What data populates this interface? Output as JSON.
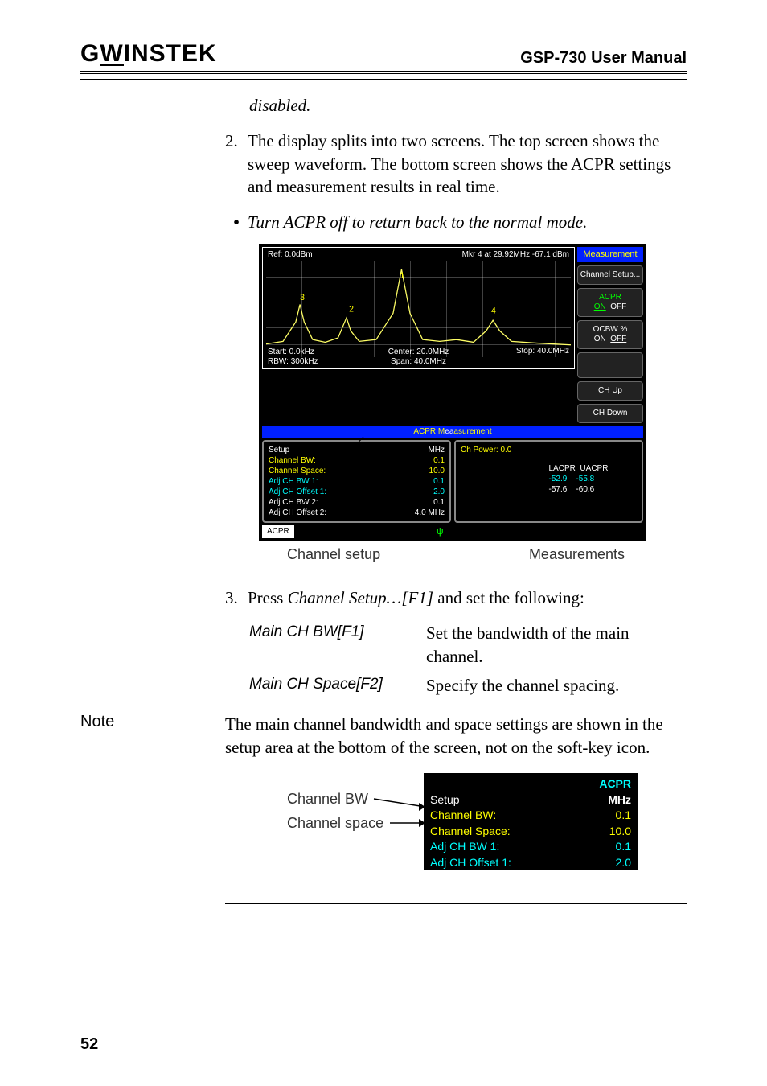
{
  "header": {
    "logo_a": "G",
    "logo_b": "W",
    "logo_c": "INSTEK",
    "manual": "GSP-730 User Manual"
  },
  "body": {
    "disabled": "disabled.",
    "step2_num": "2.",
    "step2": "The display splits into two screens. The top screen shows the sweep waveform. The bottom screen shows the ACPR settings and measurement results in real time.",
    "bullet": "Turn ACPR off to return back to the normal mode.",
    "step3_num": "3.",
    "step3_a": "Press ",
    "step3_b": "Channel Setup…[F1]",
    "step3_c": " and set the following:"
  },
  "screenshot": {
    "soft_title": "Measurement",
    "ref": "Ref: 0.0dBm",
    "mk": "Mkr 4 at      29.92MHz      -67.1   dBm",
    "start": "Start: 0.0kHz",
    "rbw": "RBW: 300kHz",
    "center": "Center: 20.0MHz",
    "span": "Span: 40.0MHz",
    "stop": "Stop: 40.0MHz",
    "s1": "Channel Setup...",
    "s2a": "ACPR",
    "s2b": "ON",
    "s2c": "OFF",
    "s3a": "OCBW %",
    "s3b": "ON",
    "s3c": "OFF",
    "s4": "",
    "s5": "CH Up",
    "s6": "CH Down",
    "bar_a": "ACPR M",
    "bar_b": "asurement",
    "setup": {
      "title": "Setup",
      "unit": "MHz",
      "r1k": "Channel BW:",
      "r1v": "0.1",
      "r2k": "Channel Space:",
      "r2v": "10.0",
      "r3k": "Adj CH BW 1:",
      "r3v": "0.1",
      "r4k": "Adj CH Offset 1:",
      "r4v": "2.0",
      "r5k": "Adj CH BW 2:",
      "r5v": "0.1",
      "r6k": "Adj CH Offset 2:",
      "r6v": "4.0 MHz"
    },
    "meas": {
      "chp": "Ch Power: 0.0",
      "h1": "LACPR",
      "h2": "UACPR",
      "r1a": "-52.9",
      "r1b": "-55.8",
      "r2a": "-57.6",
      "r2b": "-60.6"
    },
    "btm": "ACPR",
    "cap_l": "Channel setup",
    "cap_r": "Measurements"
  },
  "table": {
    "k1": "Main CH BW[F1]",
    "v1": "Set the bandwidth of the main channel.",
    "k2": "Main CH Space[F2]",
    "v2": "Specify the channel spacing."
  },
  "note": {
    "label": "Note",
    "text": "The main channel bandwidth and space settings are shown in the setup area at the bottom of the screen, not on the soft-key icon."
  },
  "fig2": {
    "lab1": "Channel BW",
    "lab2": "Channel space",
    "hdr": "ACPR",
    "unit": "MHz",
    "r0": "Setup",
    "r1k": "Channel BW:",
    "r1v": "0.1",
    "r2k": "Channel Space:",
    "r2v": "10.0",
    "r3k": "Adj CH BW 1:",
    "r3v": "0.1",
    "r4k": "Adj CH Offset 1:",
    "r4v": "2.0"
  },
  "page": "52"
}
